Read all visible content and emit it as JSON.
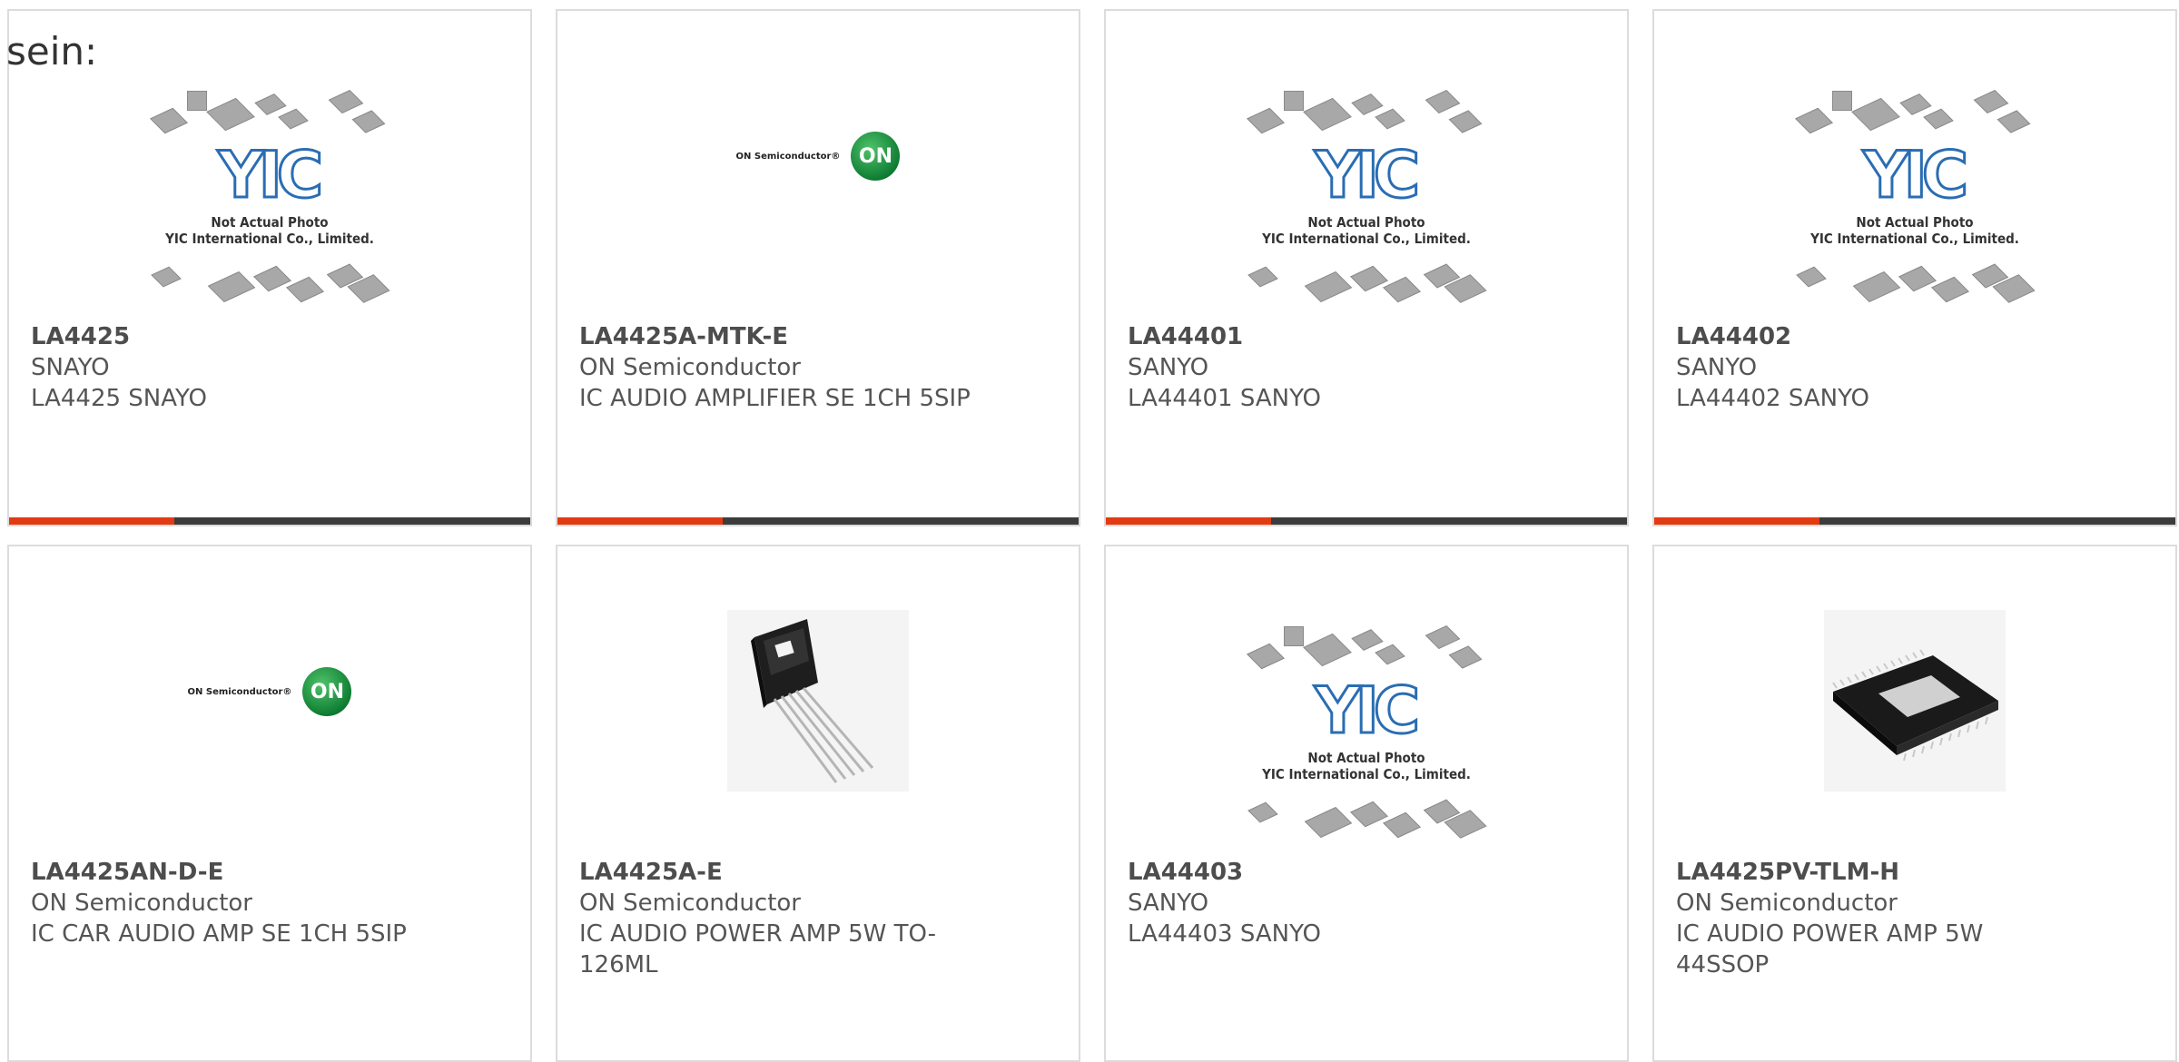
{
  "lead_text": "sein:",
  "placeholder": {
    "brand": "YIC",
    "line1": "Not Actual Photo",
    "line2": "YIC International Co., Limited."
  },
  "on_logo": {
    "text": "ON Semiconductor®",
    "mark": "ON"
  },
  "colors": {
    "accent": "#e23a12",
    "bar": "#3c3c3c",
    "border": "#dcdcdc",
    "text": "#555555"
  },
  "products": [
    {
      "part": "LA4425",
      "maker": "SNAYO",
      "desc": "LA4425 SNAYO",
      "image": "placeholder"
    },
    {
      "part": "LA4425A-MTK-E",
      "maker": "ON Semiconductor",
      "desc": "IC AUDIO AMPLIFIER SE 1CH 5SIP",
      "image": "on-logo"
    },
    {
      "part": "LA44401",
      "maker": "SANYO",
      "desc": "LA44401 SANYO",
      "image": "placeholder"
    },
    {
      "part": "LA44402",
      "maker": "SANYO",
      "desc": "LA44402 SANYO",
      "image": "placeholder"
    },
    {
      "part": "LA4425AN-D-E",
      "maker": "ON Semiconductor",
      "desc": "IC CAR AUDIO AMP SE 1CH 5SIP",
      "image": "on-logo"
    },
    {
      "part": "LA4425A-E",
      "maker": "ON Semiconductor",
      "desc": "IC AUDIO POWER AMP 5W TO-126ML",
      "image": "to126-photo"
    },
    {
      "part": "LA44403",
      "maker": "SANYO",
      "desc": "LA44403 SANYO",
      "image": "placeholder"
    },
    {
      "part": "LA4425PV-TLM-H",
      "maker": "ON Semiconductor",
      "desc": "IC AUDIO POWER AMP 5W 44SSOP",
      "image": "ssop-photo"
    }
  ]
}
